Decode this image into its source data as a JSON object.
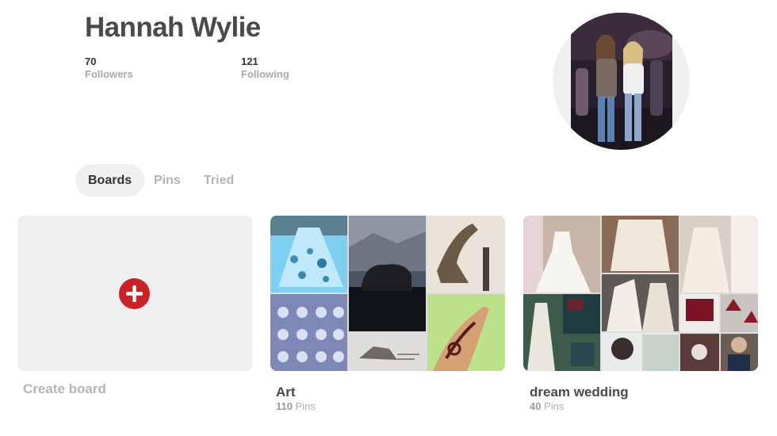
{
  "profile": {
    "name": "Hannah Wylie",
    "followers": {
      "count": "70",
      "label": "Followers"
    },
    "following": {
      "count": "121",
      "label": "Following"
    }
  },
  "tabs": [
    {
      "label": "Boards",
      "active": true
    },
    {
      "label": "Pins",
      "active": false
    },
    {
      "label": "Tried",
      "active": false
    }
  ],
  "create_board": {
    "label": "Create board",
    "icon": "plus-circle-icon",
    "accent": "#c92228"
  },
  "boards": [
    {
      "title": "Art",
      "pin_count": "110",
      "pin_label": "Pins"
    },
    {
      "title": "dream wedding",
      "pin_count": "40",
      "pin_label": "Pins"
    }
  ]
}
